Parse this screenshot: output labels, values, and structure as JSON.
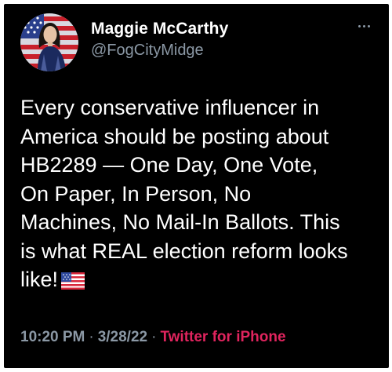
{
  "tweet": {
    "author": {
      "display_name": "Maggie McCarthy",
      "handle": "@FogCityMidge",
      "avatar_icon": "avatar-photo-flag-background"
    },
    "more_icon": "more-horizontal-icon",
    "text": "Every conservative influencer in\nAmerica should be posting about\nHB2289 — One Day, One Vote,\nOn Paper, In Person, No\nMachines, No Mail-In Ballots. This\nis what REAL election reform looks\nlike!",
    "emoji": "us-flag-emoji",
    "time": "10:20 PM",
    "separator": "·",
    "date": "3/28/22",
    "source": "Twitter for iPhone"
  },
  "colors": {
    "background": "#000000",
    "text": "#ffffff",
    "secondary": "#8b98a5",
    "source_link": "#e0245e"
  }
}
